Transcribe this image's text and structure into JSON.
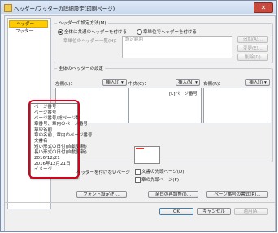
{
  "window": {
    "title": "ヘッダー/フッターの詳細設定(印刷ページ)",
    "close_glyph": "✕"
  },
  "sidebar": {
    "items": [
      {
        "label": "ヘッダー",
        "selected": true
      },
      {
        "label": "フッター",
        "selected": false
      }
    ]
  },
  "header_method": {
    "group_label": "ヘッダーの設定方法(M)",
    "option_common": "全体に共通のヘッダーを付ける",
    "option_individual": "章単位でヘッダーを付ける",
    "chapter_header_label": "章単位のヘッダー一覧(H)：",
    "chapter_header_value": "設定範囲",
    "buttons": [
      "追加(A)...",
      "変更(E)...",
      "削除(D)"
    ]
  },
  "common_header": {
    "group_label": "全体のヘッダーの設定",
    "left_label": "左側(L)：",
    "center_label": "中央(C)：",
    "right_label": "右側(R)：",
    "insert_label": "挿入(I) ▾",
    "insert_n_label": "挿入(N) ▾",
    "center_value": "[k]ページ番号",
    "menu_items": [
      "ページ番号",
      "ページ番号",
      "ページ番号/総ページ数",
      "章番号、章内のページ番号",
      "章の名前",
      "章の名前、章内のページ番号",
      "文書名",
      "短い形式の日付(自動更新)",
      "長い形式の日付(自動更新)",
      "2016/12/21",
      "2016年12月21日",
      "イメージ..."
    ]
  },
  "no_header_pages": {
    "label": "ヘッダーを付けないページ",
    "option_first": "文書の先頭ページ(D)",
    "option_chapter_first": "章の先頭ページ(P)"
  },
  "bottom_buttons": {
    "font": "フォント設定(F)...",
    "margin": "余白の再調整(J)...",
    "page_format": "ページ番号の書式(R)..."
  },
  "dialog_buttons": {
    "ok": "OK",
    "cancel": "キャンセル",
    "apply": "適用(A)"
  },
  "colors": {
    "highlight": "#d9001b",
    "selected": "#ffcc00"
  }
}
